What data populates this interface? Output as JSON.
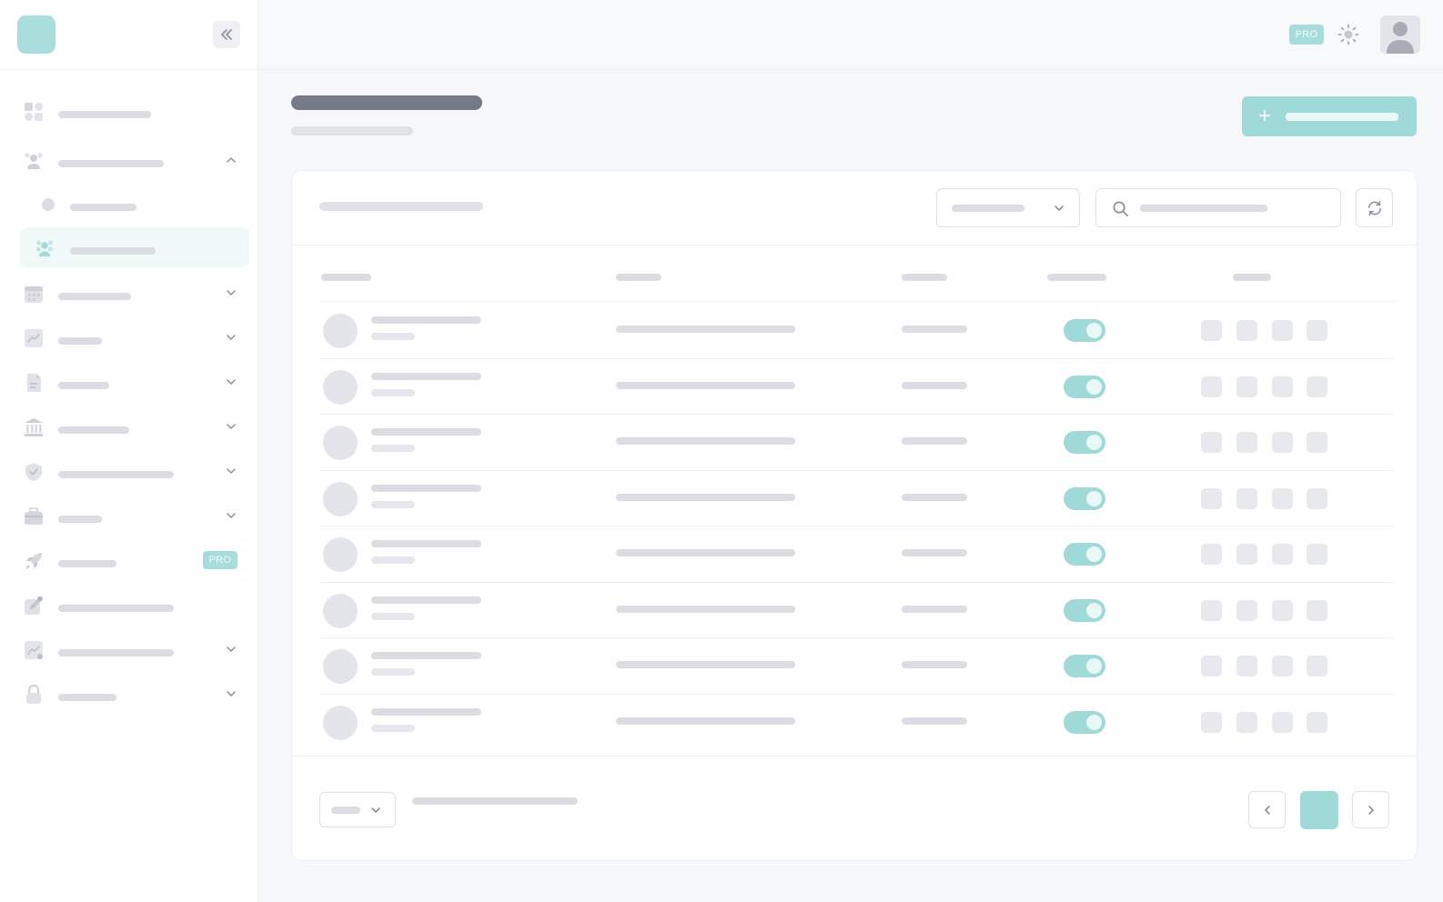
{
  "app": {
    "title": ""
  },
  "header": {
    "pro_badge": "PRO"
  },
  "sidebar": {
    "items": [
      {
        "id": "dashboard",
        "icon": "grid-icon",
        "has_chevron": false
      },
      {
        "id": "users",
        "icon": "users-icon",
        "has_chevron": true,
        "expanded": true
      },
      {
        "id": "users-sub-list",
        "icon": "dot-icon",
        "sub": true
      },
      {
        "id": "users-sub-active",
        "icon": "users-icon",
        "sub": true,
        "active": true
      },
      {
        "id": "calendar",
        "icon": "calendar-icon",
        "has_chevron": true
      },
      {
        "id": "analytics",
        "icon": "chart-icon",
        "has_chevron": true
      },
      {
        "id": "documents",
        "icon": "document-icon",
        "has_chevron": true
      },
      {
        "id": "bank",
        "icon": "bank-icon",
        "has_chevron": true
      },
      {
        "id": "security",
        "icon": "shield-check-icon",
        "has_chevron": true
      },
      {
        "id": "jobs",
        "icon": "briefcase-icon",
        "has_chevron": true
      },
      {
        "id": "launch",
        "icon": "rocket-icon",
        "badge": "PRO"
      },
      {
        "id": "edit",
        "icon": "edit-icon",
        "has_chevron": false
      },
      {
        "id": "reports",
        "icon": "chart-icon",
        "has_chevron": true
      },
      {
        "id": "lock",
        "icon": "lock-icon",
        "has_chevron": true
      }
    ]
  },
  "colors": {
    "accent": "#9fd9d8",
    "accent_light": "#a9dedd",
    "active_bg": "#f1f8f8",
    "skeleton": "#dcdde3"
  },
  "table": {
    "rows": [
      {
        "enabled": true
      },
      {
        "enabled": true
      },
      {
        "enabled": true
      },
      {
        "enabled": true
      },
      {
        "enabled": true
      },
      {
        "enabled": true
      },
      {
        "enabled": true
      },
      {
        "enabled": true
      }
    ]
  },
  "pagination": {
    "current_page_highlighted": true
  }
}
